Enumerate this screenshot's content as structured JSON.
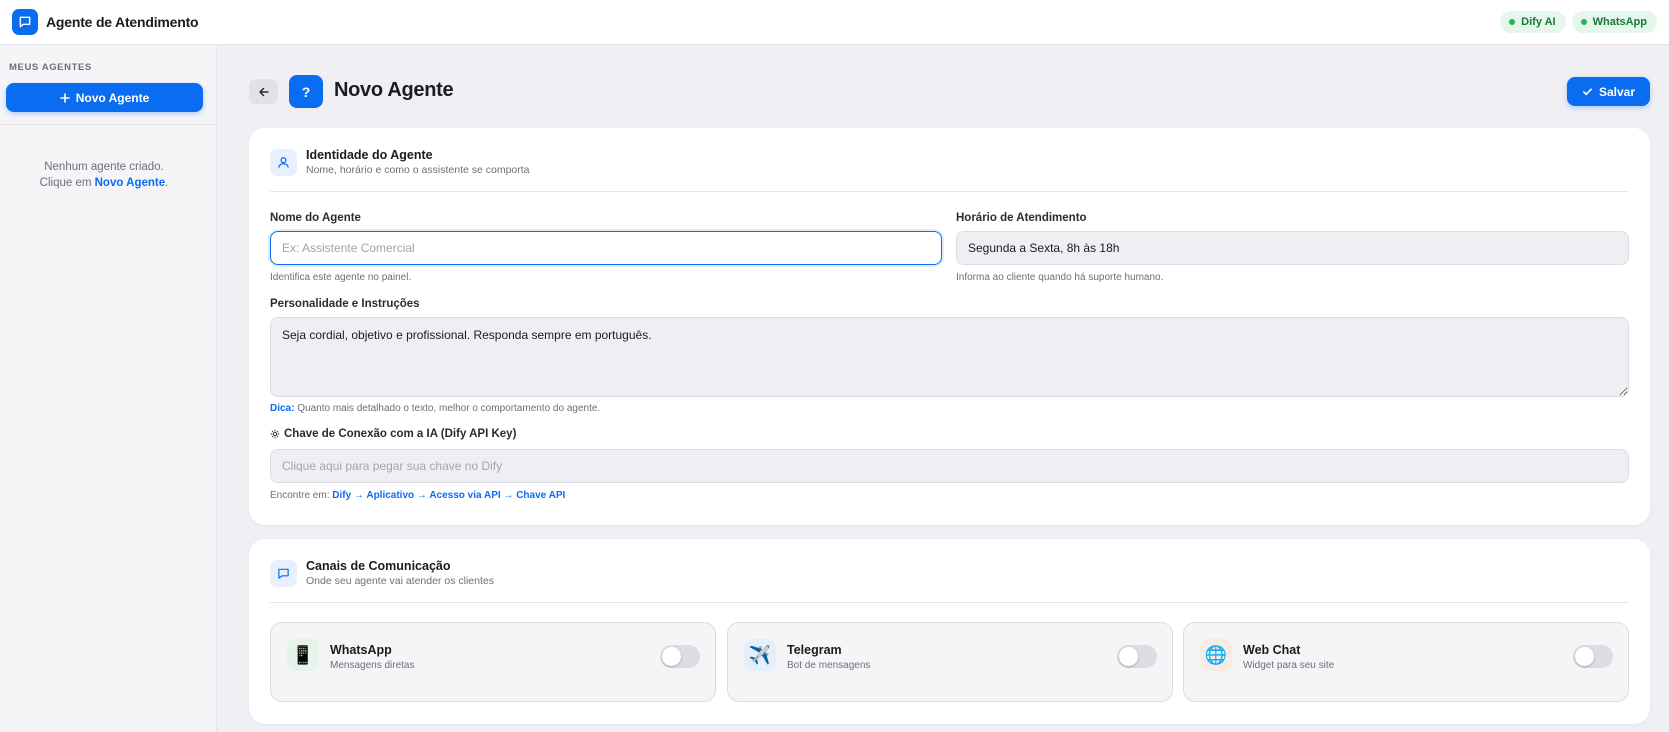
{
  "app": {
    "title": "Agente de Atendimento",
    "status_badges": [
      {
        "label": "Dify AI",
        "color": "#27b35a"
      },
      {
        "label": "WhatsApp",
        "color": "#27b35a"
      }
    ],
    "accent_color": "#0a6cf0"
  },
  "sidebar": {
    "heading": "MEUS AGENTES",
    "new_agent_label": "Novo Agente",
    "empty_line1": "Nenhum agente criado.",
    "empty_line2_prefix": "Clique em ",
    "empty_line2_link": "Novo Agente",
    "empty_line2_suffix": "."
  },
  "header": {
    "avatar_glyph": "?",
    "title": "Novo Agente",
    "save_label": "Salvar"
  },
  "identity": {
    "title": "Identidade do Agente",
    "subtitle": "Nome, horário e como o assistente se comporta",
    "name_label": "Nome do Agente",
    "name_value": "",
    "name_placeholder": "Ex: Assistente Comercial",
    "name_hint": "Identifica este agente no painel.",
    "hours_label": "Horário de Atendimento",
    "hours_value": "Segunda a Sexta, 8h às 18h",
    "hours_hint": "Informa ao cliente quando há suporte humano.",
    "personality_label": "Personalidade e Instruções",
    "personality_value": "Seja cordial, objetivo e profissional. Responda sempre em português.",
    "personality_hint_prefix": "Dica:",
    "personality_hint": " Quanto mais detalhado o texto, melhor o comportamento do agente.",
    "apikey_label": "Chave de Conexão com a IA (Dify API Key)",
    "apikey_value": "",
    "apikey_placeholder": "Clique aqui para pegar sua chave no Dify",
    "apikey_hint_prefix": "Encontre em: ",
    "apikey_hint_path": "Dify → Aplicativo → Acesso via API → Chave API"
  },
  "channels": {
    "title": "Canais de Comunicação",
    "subtitle": "Onde seu agente vai atender os clientes",
    "items": [
      {
        "name": "WhatsApp",
        "description": "Mensagens diretas",
        "icon": "📱",
        "icon_bg": "#e5f3ea",
        "enabled": false
      },
      {
        "name": "Telegram",
        "description": "Bot de mensagens",
        "icon": "✈️",
        "icon_bg": "#e6eefa",
        "enabled": false
      },
      {
        "name": "Web Chat",
        "description": "Widget para seu site",
        "icon": "🌐",
        "icon_bg": "#f7ece4",
        "enabled": false
      }
    ]
  }
}
